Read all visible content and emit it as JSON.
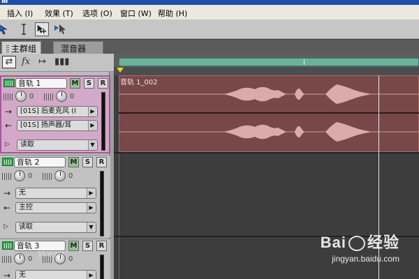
{
  "menu": [
    "插入 (I)",
    "效果 (T)",
    "选项 (O)",
    "窗口 (W)",
    "帮助 (H)"
  ],
  "icons": {
    "move": "move-arrow-icon",
    "ibeam": "i-beam-icon",
    "move_copy": "move-copy-icon",
    "hybrid": "hybrid-select-icon",
    "routing": "routing-icon",
    "fx": "fx-icon",
    "send": "send-icon",
    "eq": "eq-icon"
  },
  "tabs": [
    "主群组",
    "混音器"
  ],
  "subbar": {
    "fx_label": "fx"
  },
  "clip": {
    "title": "音轨 1_002"
  },
  "tracks": [
    {
      "name": "音轨 1",
      "m": "M",
      "s": "S",
      "r": "R",
      "volume": "0",
      "pan": "0",
      "input": "[01S] 后麦克风 (I",
      "output": "[01S] 扬声器/耳",
      "automation": "读取"
    },
    {
      "name": "音轨 2",
      "m": "M",
      "s": "S",
      "r": "R",
      "volume": "0",
      "pan": "0",
      "input": "无",
      "output": "主控",
      "automation": "读取"
    },
    {
      "name": "音轨 3",
      "m": "M",
      "s": "S",
      "r": "R",
      "volume": "0",
      "pan": "0",
      "input": "无"
    }
  ],
  "watermark": {
    "brand_left": "Bai",
    "brand_right": "经验",
    "url": "jingyan.baidu.com"
  },
  "colors": {
    "selected_track": "#d4a8c9",
    "clip": "#784848",
    "waveform": "#dca8a8",
    "overview": "#6ab19d"
  }
}
